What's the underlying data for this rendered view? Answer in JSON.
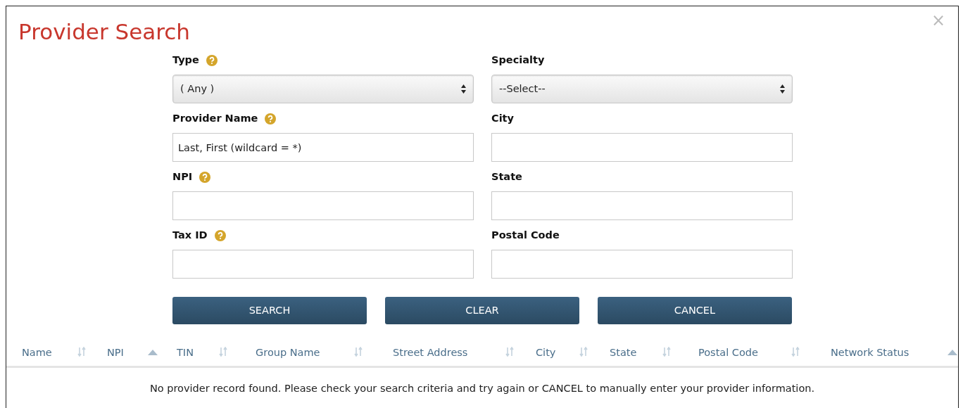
{
  "dialog": {
    "title": "Provider Search",
    "close": "×"
  },
  "fields": [
    {
      "kind": "select",
      "label": "Type",
      "help": true,
      "value": "( Any )"
    },
    {
      "kind": "select",
      "label": "Specialty",
      "help": false,
      "value": "--Select--"
    },
    {
      "kind": "input",
      "label": "Provider Name",
      "help": true,
      "placeholder": "Last, First (wildcard = *)"
    },
    {
      "kind": "input",
      "label": "City",
      "help": false
    },
    {
      "kind": "input",
      "label": "NPI",
      "help": true
    },
    {
      "kind": "input",
      "label": "State",
      "help": false
    },
    {
      "kind": "input",
      "label": "Tax ID",
      "help": true
    },
    {
      "kind": "input",
      "label": "Postal Code",
      "help": false
    }
  ],
  "buttons": [
    "SEARCH",
    "CLEAR",
    "CANCEL"
  ],
  "table": {
    "columns": [
      {
        "label": "Name",
        "sorted": false
      },
      {
        "label": "NPI",
        "sorted": true
      },
      {
        "label": "TIN",
        "sorted": false
      },
      {
        "label": "Group Name",
        "sorted": false
      },
      {
        "label": "Street Address",
        "sorted": false
      },
      {
        "label": "City",
        "sorted": false
      },
      {
        "label": "State",
        "sorted": false
      },
      {
        "label": "Postal Code",
        "sorted": false
      },
      {
        "label": "Network Status",
        "sorted": true
      }
    ],
    "empty_message": "No provider record found. Please check your search criteria and try again or CANCEL to manually enter your provider information."
  }
}
